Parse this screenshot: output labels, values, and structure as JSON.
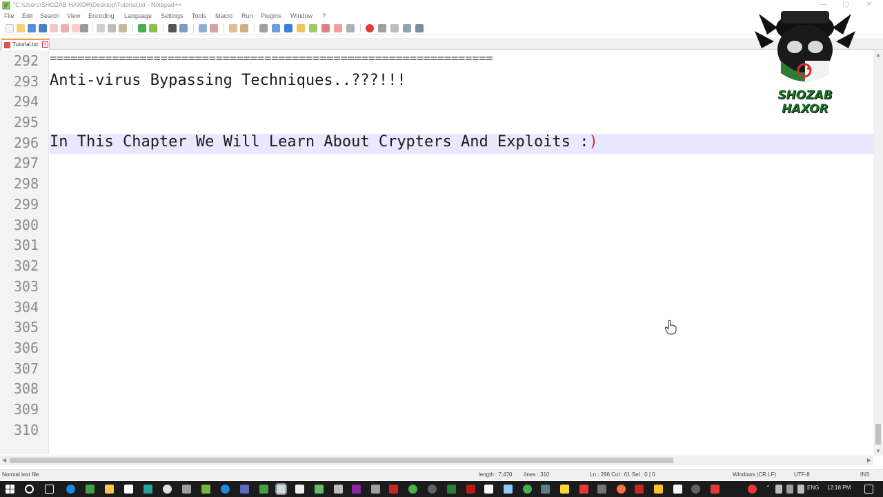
{
  "window": {
    "title": "\"C:\\Users\\SHOZAB HAXOR\\Desktop\\Tutorial.txt - Notepad++"
  },
  "menu": {
    "items": [
      "File",
      "Edit",
      "Search",
      "View",
      "Encoding",
      "Language",
      "Settings",
      "Tools",
      "Macro",
      "Run",
      "Plugins",
      "Window",
      "?"
    ]
  },
  "tab": {
    "label": "Tutorial.txt",
    "close_glyph": "x"
  },
  "editor": {
    "lines": [
      {
        "num": "292",
        "text": "================================================================"
      },
      {
        "num": "293",
        "text": "Anti-virus Bypassing Techniques..???!!!"
      },
      {
        "num": "294",
        "text": ""
      },
      {
        "num": "295",
        "text": ""
      },
      {
        "num": "296",
        "text": "In This Chapter We Will Learn About Crypters And Exploits :"
      },
      {
        "num": "297",
        "text": ""
      },
      {
        "num": "298",
        "text": ""
      },
      {
        "num": "299",
        "text": ""
      },
      {
        "num": "300",
        "text": ""
      },
      {
        "num": "301",
        "text": ""
      },
      {
        "num": "302",
        "text": ""
      },
      {
        "num": "303",
        "text": ""
      },
      {
        "num": "304",
        "text": ""
      },
      {
        "num": "305",
        "text": ""
      },
      {
        "num": "306",
        "text": ""
      },
      {
        "num": "307",
        "text": ""
      },
      {
        "num": "308",
        "text": ""
      },
      {
        "num": "309",
        "text": ""
      },
      {
        "num": "310",
        "text": ""
      }
    ],
    "current_line_tail": ")"
  },
  "status": {
    "file_type": "Normal text file",
    "length": "length : 7,470",
    "lines": "lines : 310",
    "position": "Ln : 296    Col : 61    Sel : 0 | 0",
    "eol": "Windows (CR LF)",
    "encoding": "UTF-8",
    "mode": "INS"
  },
  "taskbar": {
    "language": "ENG",
    "time": "12:18 PM"
  },
  "watermark": {
    "text": "SHOZAB HAXOR"
  },
  "colors": {
    "current_line": "#e8e8ff",
    "tab_accent": "#f29c3a",
    "watermark_green": "#1a6e2a"
  }
}
